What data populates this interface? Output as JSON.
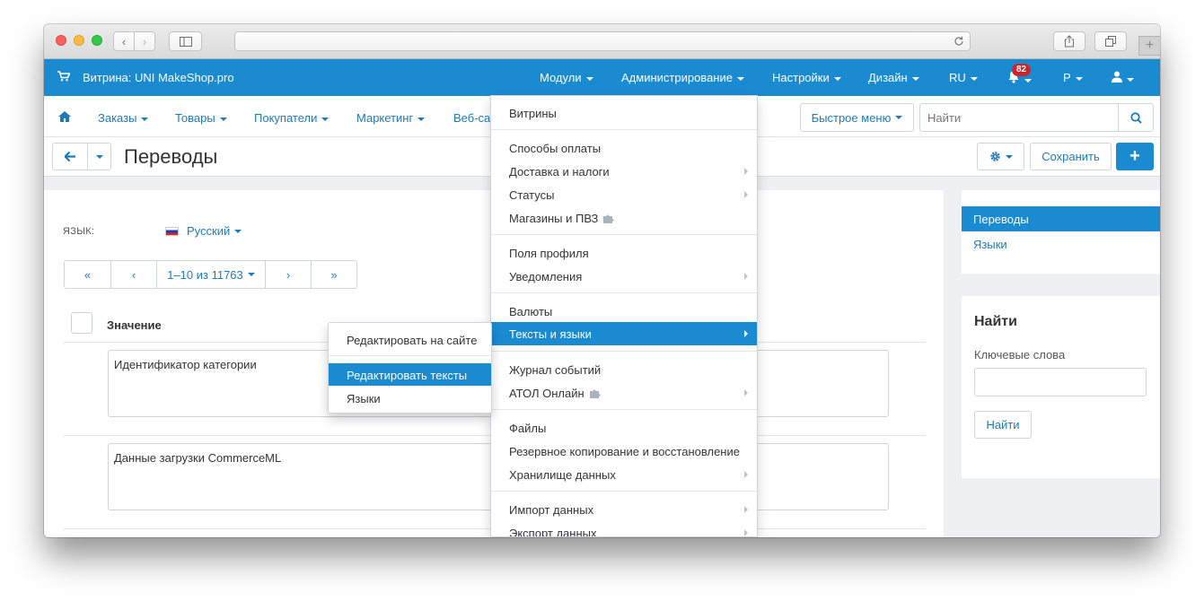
{
  "browser": {
    "back_icon": "‹",
    "forward_icon": "›",
    "new_tab_icon": "+"
  },
  "topbar": {
    "store": "Витрина: UNI MakeShop.pro",
    "menus": [
      "Модули",
      "Администрирование",
      "Настройки",
      "Дизайн",
      "RU"
    ],
    "notifications_count": "82",
    "profile_label": "Р"
  },
  "nav": {
    "items": [
      "Заказы",
      "Товары",
      "Покупатели",
      "Маркетинг",
      "Веб-са"
    ],
    "quick_menu": "Быстрое меню",
    "search_placeholder": "Найти"
  },
  "page": {
    "title": "Переводы",
    "save": "Сохранить",
    "add": "+"
  },
  "main": {
    "lang_label": "ЯЗЫК:",
    "lang_value": "Русский",
    "pager": [
      "«",
      "‹",
      "1–10 из 11763",
      "›",
      "»"
    ],
    "column_header": "Значение",
    "rows": [
      "Идентификатор категории",
      "Данные загрузки CommerceML"
    ]
  },
  "sidebar": {
    "active": "Переводы",
    "link": "Языки",
    "search_title": "Найти",
    "keywords_label": "Ключевые слова",
    "search_button": "Найти"
  },
  "admin_menu": {
    "items": [
      "Витрины",
      "Способы оплаты",
      "Доставка и налоги",
      "Статусы",
      "Магазины и ПВЗ",
      "Поля профиля",
      "Уведомления",
      "Валюты",
      "Тексты и языки",
      "Журнал событий",
      "АТОЛ Онлайн",
      "Файлы",
      "Резервное копирование и восстановление",
      "Хранилище данных",
      "Импорт данных",
      "Экспорт данных"
    ]
  },
  "submenu": {
    "items": [
      "Редактировать на сайте",
      "Редактировать тексты",
      "Языки"
    ]
  },
  "colors": {
    "primary": "#1a8ad1",
    "link": "#1f7ab7",
    "badge": "#c8262b"
  }
}
